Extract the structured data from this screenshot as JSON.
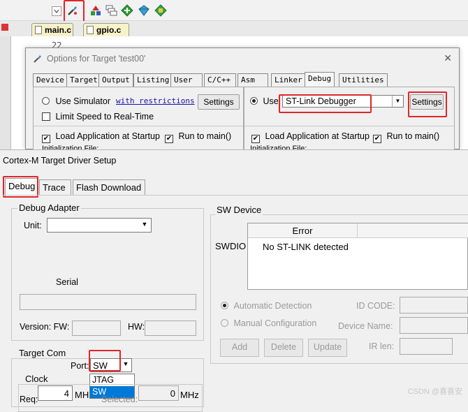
{
  "editor": {
    "tabs": [
      "main.c",
      "gpio.c"
    ],
    "line_number": "22"
  },
  "toolbar": {
    "icons": [
      "dropdown-arrow-icon",
      "options-for-target-icon",
      "manage-run-time-icon",
      "file-extensions-icon",
      "pack-installer-icon",
      "select-packs-icon",
      "manage-components-icon"
    ]
  },
  "options_dialog": {
    "title": "Options for Target 'test00'",
    "close": "✕",
    "tabs": [
      "Device",
      "Target",
      "Output",
      "Listing",
      "User",
      "C/C++",
      "Asm",
      "Linker",
      "Debug",
      "Utilities"
    ],
    "active_tab": "Debug",
    "left": {
      "use_simulator": "Use Simulator",
      "restrictions_link": "with restrictions",
      "settings": "Settings",
      "limit_speed": "Limit Speed to Real-Time",
      "load_app": "Load Application at Startup",
      "run_to_main": "Run to main()",
      "init_file": "Initialization File:"
    },
    "right": {
      "use": "Use:",
      "debugger": "ST-Link Debugger",
      "settings": "Settings",
      "load_app": "Load Application at Startup",
      "run_to_main": "Run to main()",
      "init_file": "Initialization File:"
    }
  },
  "driver_dialog": {
    "title": "Cortex-M Target Driver Setup",
    "tabs": [
      "Debug",
      "Trace",
      "Flash Download"
    ],
    "active_tab": "Debug",
    "debug_adapter": {
      "title": "Debug Adapter",
      "unit_label": "Unit:",
      "unit_value": "",
      "serial_label": "Serial",
      "serial_value": "",
      "version_label": "Version: FW:",
      "fw_value": "",
      "hw_label": "HW:",
      "hw_value": ""
    },
    "target_com": {
      "title": "Target Com",
      "port_label": "Port:",
      "port_value": "SW",
      "port_options": [
        "JTAG",
        "SW"
      ],
      "selected_option": "SW",
      "clock_title": "Clock",
      "req_label": "Req:",
      "req_value": "4",
      "req_unit": "MH",
      "selected_label": "Selected:",
      "selected_value": "0",
      "selected_unit": "MHz"
    },
    "sw_device": {
      "title": "SW Device",
      "col_error": "Error",
      "row_label": "SWDIO",
      "row_message": "No ST-LINK detected",
      "auto_detection": "Automatic Detection",
      "manual_config": "Manual Configuration",
      "id_code_label": "ID CODE:",
      "device_name_label": "Device Name:",
      "ir_len_label": "IR len:",
      "add": "Add",
      "delete": "Delete",
      "update": "Update"
    }
  },
  "watermark": "CSDN @喜喜安",
  "colors": {
    "highlight": "#e0252b",
    "selection": "#0078d7",
    "link": "#1a0dab"
  }
}
